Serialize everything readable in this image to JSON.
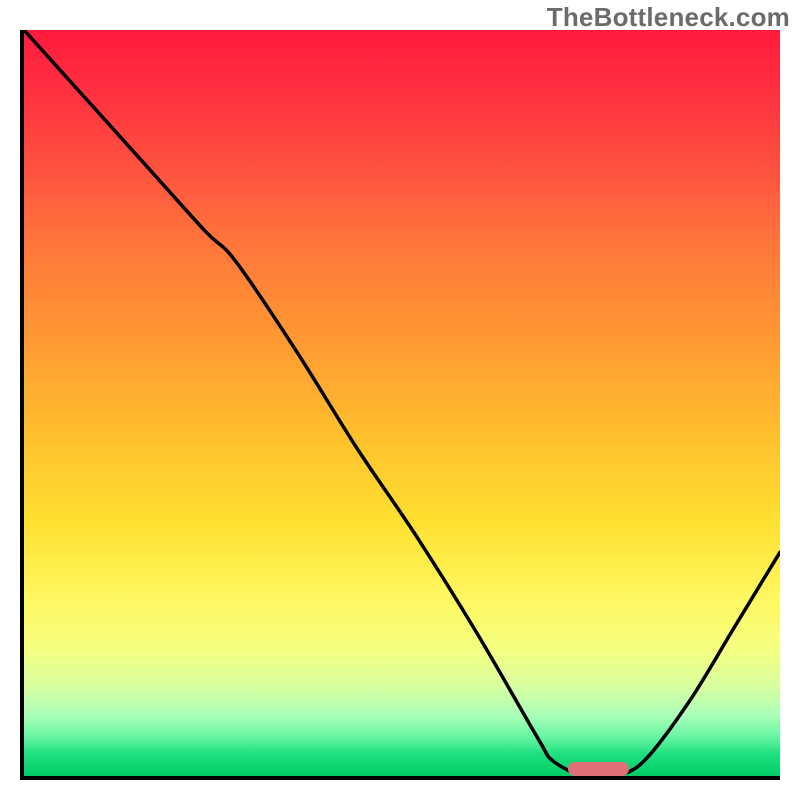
{
  "watermark": "TheBottleneck.com",
  "chart_data": {
    "type": "line",
    "title": "",
    "xlabel": "",
    "ylabel": "",
    "xlim": [
      0,
      100
    ],
    "ylim": [
      0,
      100
    ],
    "grid": false,
    "legend": false,
    "annotations": [],
    "series": [
      {
        "name": "bottleneck-curve",
        "color": "#000000",
        "x": [
          0,
          8,
          16,
          24,
          28,
          36,
          44,
          52,
          60,
          68,
          70,
          74,
          78,
          82,
          88,
          94,
          100
        ],
        "y": [
          100,
          91,
          82,
          73,
          69,
          57,
          44,
          32,
          19,
          5,
          2,
          0,
          0,
          2,
          10,
          20,
          30
        ]
      }
    ],
    "marker": {
      "x_start": 72,
      "x_end": 80,
      "y": 0,
      "color": "#e07078"
    }
  }
}
